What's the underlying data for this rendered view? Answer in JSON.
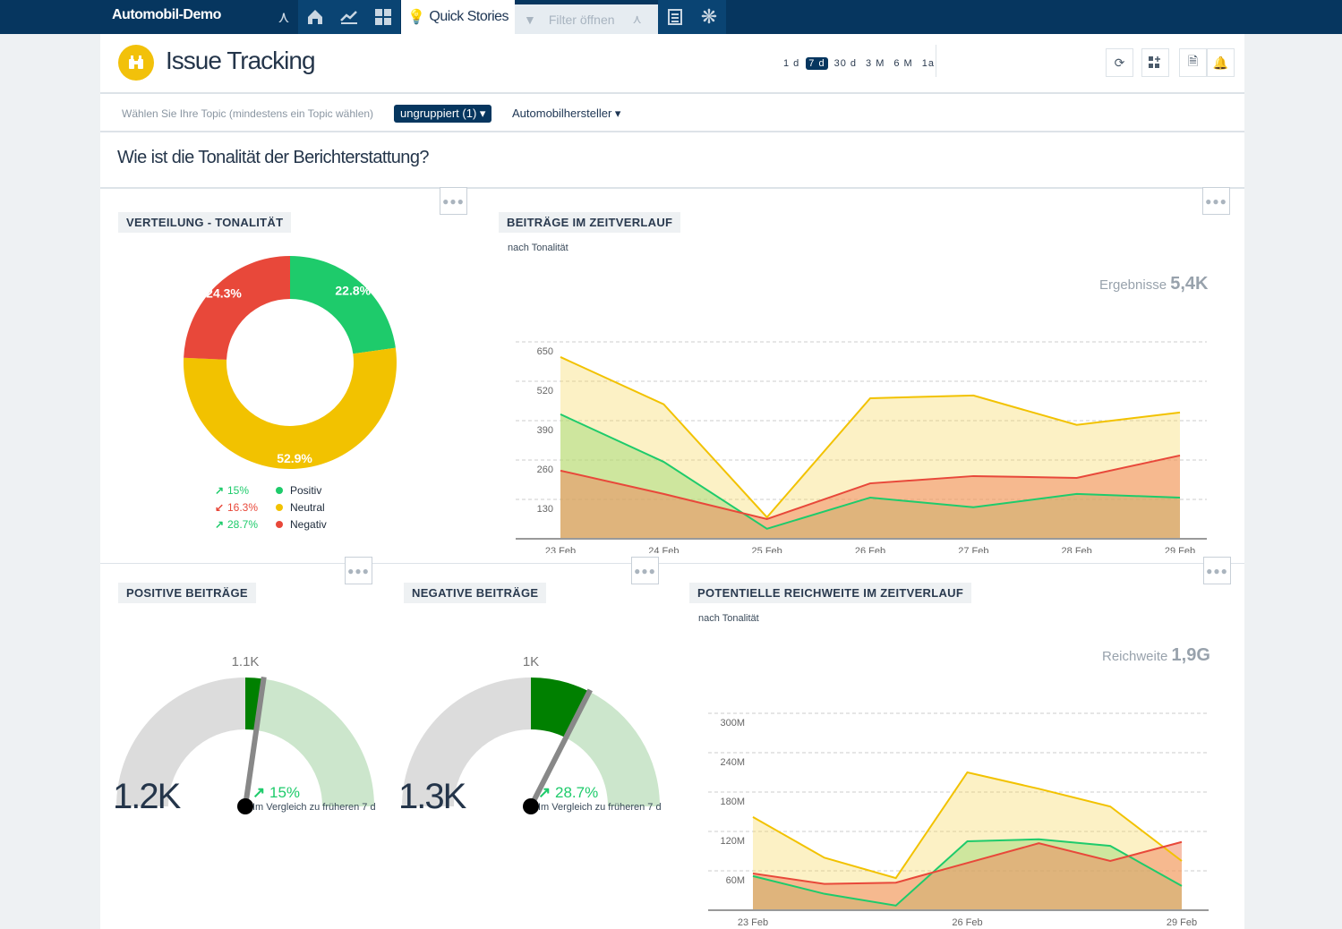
{
  "topbar": {
    "brand": "Automobil-Demo",
    "quick_stories": "Quick Stories",
    "filter_placeholder": "Filter öffnen",
    "icons": [
      "chevron-double-down-icon",
      "home-icon",
      "chart-line-icon",
      "dashboard-grid-icon",
      "lightbulb-icon",
      "filter-icon",
      "report-icon",
      "gear-icon"
    ]
  },
  "header": {
    "title": "Issue Tracking",
    "logo_icon": "binoculars-icon",
    "periods": [
      "1 d",
      "7 d",
      "30 d",
      "3 M",
      "6 M",
      "1a"
    ],
    "active_period": "7 d",
    "actions": [
      "refresh-icon",
      "add-widget-icon",
      "add-report-icon",
      "add-alert-icon"
    ]
  },
  "topics": {
    "label": "Wählen Sie Ihre Topic (mindestens ein Topic wählen)",
    "group": "ungruppiert (1)",
    "category": "Automobilhersteller"
  },
  "question": "Wie ist die Tonalität der Berichterstattung?",
  "colors": {
    "positiv": "#1ecb6b",
    "neutral": "#f2c200",
    "negativ": "#e8483a",
    "navy": "#06365f"
  },
  "widgets": {
    "donut": {
      "title": "VERTEILUNG - TONALITÄT",
      "labels": [
        "22.8%",
        "52.9%",
        "24.3%"
      ],
      "legend": [
        {
          "change": "15%",
          "dir": "up",
          "name": "Positiv"
        },
        {
          "change": "16.3%",
          "dir": "down",
          "name": "Neutral"
        },
        {
          "change": "28.7%",
          "dir": "up",
          "name": "Negativ"
        }
      ]
    },
    "timeline": {
      "title": "BEITRÄGE IM ZEITVERLAUF",
      "subtitle": "nach Tonalität",
      "total_label": "Ergebnisse",
      "total_value": "5,4K"
    },
    "positive": {
      "title": "POSITIVE BEITRÄGE",
      "reference": "1.1K",
      "value": "1.2K",
      "change": "15%",
      "compare": "Im Vergleich zu früheren 7 d"
    },
    "negative": {
      "title": "NEGATIVE BEITRÄGE",
      "reference": "1K",
      "value": "1.3K",
      "change": "28.7%",
      "compare": "Im Vergleich zu früheren 7 d"
    },
    "reach": {
      "title": "POTENTIELLE REICHWEITE IM ZEITVERLAUF",
      "subtitle": "nach Tonalität",
      "total_label": "Reichweite",
      "total_value": "1,9G"
    }
  },
  "chart_data": [
    {
      "type": "pie",
      "variant": "donut",
      "categories": [
        "Positiv",
        "Neutral",
        "Negativ"
      ],
      "values": [
        22.8,
        52.9,
        24.3
      ],
      "unit": "%"
    },
    {
      "type": "area",
      "x": [
        "23 Feb",
        "24 Feb",
        "25 Feb",
        "26 Feb",
        "27 Feb",
        "28 Feb",
        "29 Feb"
      ],
      "x_tick_labels": [
        "23 Feb",
        "24 Feb",
        "25 Feb",
        "26 Feb",
        "27 Feb",
        "28 Feb",
        "29 Feb"
      ],
      "y_ticks": [
        "130",
        "260",
        "390",
        "520",
        "650"
      ],
      "ylim": [
        0,
        650
      ],
      "grid": true,
      "legend": "bottom",
      "series": [
        {
          "name": "Positiv",
          "values": [
            411,
            254,
            33,
            136,
            104,
            148,
            136
          ]
        },
        {
          "name": "Neutral",
          "values": [
            600,
            444,
            71,
            464,
            473,
            376,
            417
          ]
        },
        {
          "name": "Negativ",
          "values": [
            225,
            148,
            65,
            183,
            207,
            201,
            275
          ]
        }
      ]
    },
    {
      "type": "gauge",
      "value": 1.2,
      "reference": 1.1,
      "unit": "K",
      "max": 2.2
    },
    {
      "type": "gauge",
      "value": 1.3,
      "reference": 1.0,
      "unit": "K",
      "max": 2.0
    },
    {
      "type": "area",
      "x": [
        "23 Feb",
        "24 Feb",
        "25 Feb",
        "26 Feb",
        "27 Feb",
        "28 Feb",
        "29 Feb"
      ],
      "x_tick_labels": [
        "23 Feb",
        "26 Feb",
        "29 Feb"
      ],
      "y_ticks": [
        "60M",
        "120M",
        "180M",
        "240M",
        "300M"
      ],
      "ylim": [
        0,
        300
      ],
      "unit": "M",
      "grid": true,
      "legend": "bottom",
      "series": [
        {
          "name": "Positiv",
          "values": [
            52,
            25,
            7,
            105,
            108,
            98,
            37
          ]
        },
        {
          "name": "Neutral",
          "values": [
            142,
            80,
            49,
            210,
            185,
            158,
            75
          ]
        },
        {
          "name": "Negativ",
          "values": [
            56,
            40,
            42,
            72,
            102,
            75,
            104
          ]
        }
      ]
    }
  ]
}
